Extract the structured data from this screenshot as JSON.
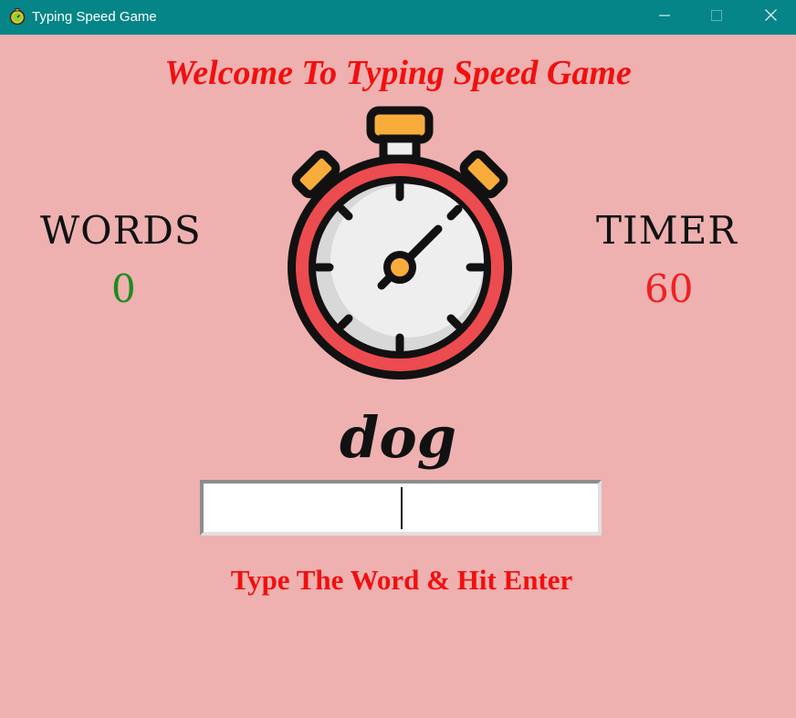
{
  "window": {
    "title": "Typing Speed Game",
    "app_icon": "stopwatch-icon",
    "controls": [
      "minimize-icon",
      "maximize-icon",
      "close-icon"
    ],
    "titlebar_color": "#058587"
  },
  "game": {
    "heading": "Welcome To Typing Speed Game",
    "words_label": "WORDS",
    "words_value": "0",
    "timer_label": "TIMER",
    "timer_value": "60",
    "current_word": "dog",
    "entry_value": "",
    "instruction": "Type The Word & Hit Enter"
  },
  "colors": {
    "background": "#eeb1b0",
    "heading": "#f20f0f",
    "words_value": "#1e8a1e",
    "timer_value": "#f02020"
  }
}
